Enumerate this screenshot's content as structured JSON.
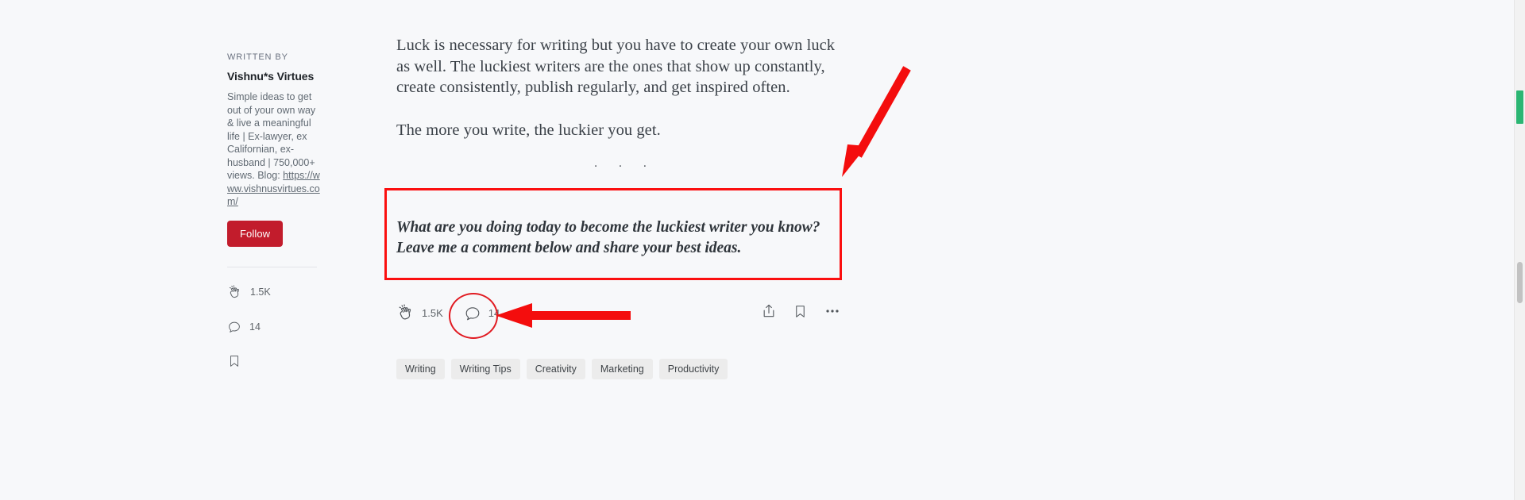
{
  "sidebar": {
    "written_by_label": "WRITTEN BY",
    "author_name": "Vishnu*s Virtues",
    "bio_text": "Simple ideas to get out of your own way & live a meaningful life | Ex-lawyer, ex Californian, ex-husband | 750,000+ views. Blog: ",
    "bio_link": "https://www.vishnusvirtues.com/",
    "follow_label": "Follow",
    "stats": [
      {
        "icon": "clap-icon",
        "value": "1.5K"
      },
      {
        "icon": "comment-icon",
        "value": "14"
      },
      {
        "icon": "bookmark-icon",
        "value": ""
      }
    ]
  },
  "article": {
    "paragraphs": [
      "Luck is necessary for writing but you have to create your own luck as well. The luckiest writers are the ones that show up constantly, create consistently, publish regularly, and get inspired often.",
      "The more you write, the luckier you get."
    ],
    "divider_dots": ". . .",
    "quote": "What are you doing today to become the luckiest writer you know? Leave me a comment below and share your best ideas."
  },
  "action_bar": {
    "clap_count": "1.5K",
    "comment_count": "14",
    "icons": {
      "clap": "clap-icon",
      "comment": "comment-icon",
      "share": "share-icon",
      "bookmark": "bookmark-icon",
      "more": "more-horizontal-icon"
    }
  },
  "tags": [
    "Writing",
    "Writing Tips",
    "Creativity",
    "Marketing",
    "Productivity"
  ],
  "annotations": {
    "highlight_color": "#fb0f0f",
    "circle_color": "#e11b22",
    "arrow_color": "#f40d0d"
  },
  "theme": {
    "background": "#f7f8fa",
    "follow_button": "#c21c2c",
    "text_primary": "#3c4249",
    "text_muted": "#616a73",
    "tag_background": "#ececec",
    "scrollbar_accent": "#2bb673"
  }
}
